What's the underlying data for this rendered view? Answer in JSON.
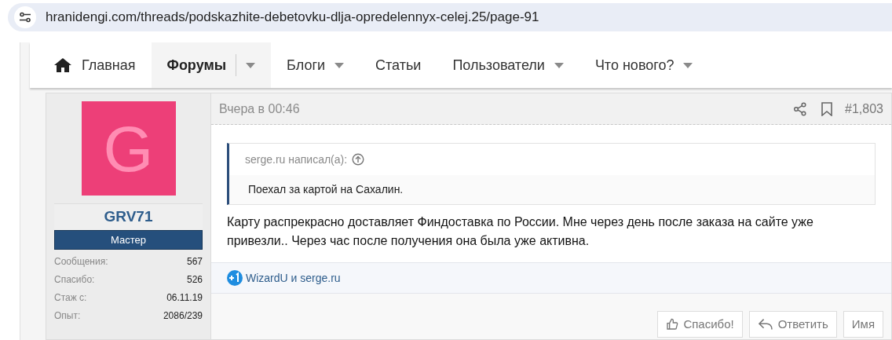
{
  "address_bar": {
    "url": "hranidengi.com/threads/podskazhite-debetovku-dlja-opredelennyx-celej.25/page-91"
  },
  "nav": [
    {
      "label": "Главная",
      "selected": false,
      "has_menu": false,
      "kind": "home"
    },
    {
      "label": "Форумы",
      "selected": true,
      "has_menu": true
    },
    {
      "label": "Блоги",
      "selected": false,
      "has_menu": true
    },
    {
      "label": "Статьи",
      "selected": false,
      "has_menu": false
    },
    {
      "label": "Пользователи",
      "selected": false,
      "has_menu": true
    },
    {
      "label": "Что нового?",
      "selected": false,
      "has_menu": true
    }
  ],
  "post": {
    "date": "Вчера в 00:46",
    "number": "#1,803",
    "user": {
      "avatar_letter": "G",
      "name": "GRV71",
      "rank": "Мастер",
      "stats": [
        {
          "label": "Сообщения:",
          "value": "567"
        },
        {
          "label": "Спасибо:",
          "value": "526"
        },
        {
          "label": "Стаж с:",
          "value": "06.11.19"
        },
        {
          "label": "Опыт:",
          "value": "2086/239"
        }
      ]
    },
    "quote": {
      "author": "serge.ru написал(а):",
      "text": "Поехал за картой на Сахалин."
    },
    "body": "Карту распрекрасно доставляет Финдоставка по России. Мне через день после заказа на сайте уже привезли.. Через час после получения она была уже активна.",
    "reactions": "WizardU и serge.ru",
    "actions": [
      {
        "label": "Спасибо!",
        "kind": "like"
      },
      {
        "label": "Ответить",
        "kind": "reply"
      },
      {
        "label": "Имя",
        "kind": "plain"
      }
    ]
  }
}
